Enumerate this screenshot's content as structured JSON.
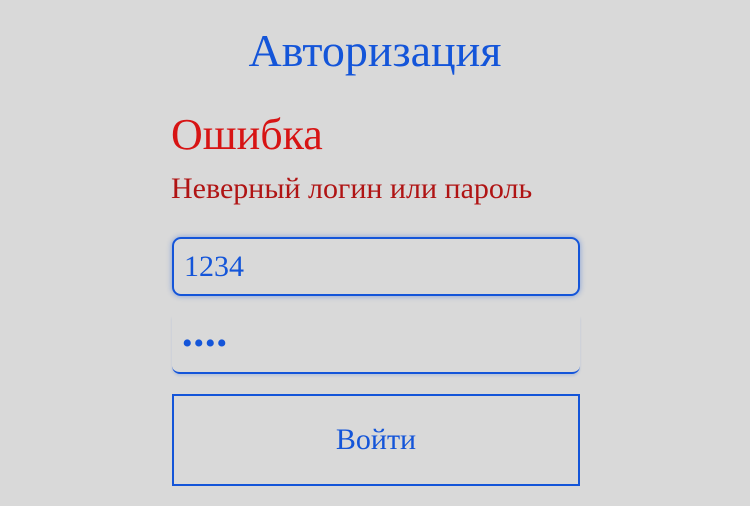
{
  "page": {
    "title": "Авторизация"
  },
  "error": {
    "heading": "Ошибка",
    "message": "Неверный логин или пароль"
  },
  "form": {
    "login_value": "1234",
    "password_value": "1234",
    "submit_label": "Войти"
  },
  "colors": {
    "background": "#d9d9d9",
    "accent": "#1455d9",
    "error_heading": "#d71414",
    "error_message": "#b01414"
  }
}
